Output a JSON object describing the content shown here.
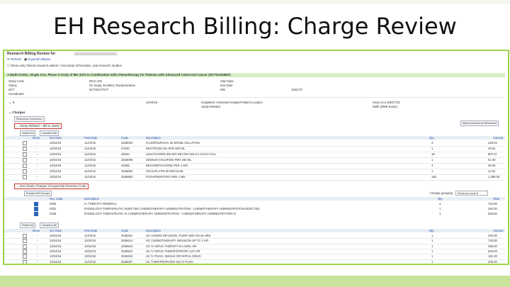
{
  "slide": {
    "title": "EH Research Billing: Charge Review"
  },
  "colors": {
    "frame": "#9bd34a",
    "banner": "#d6efc4",
    "highlight": "#d0342c"
  },
  "app": {
    "page_heading": "Research Billing Review for",
    "toolbar": {
      "refresh": "Refresh",
      "expand": "Expand/collapse"
    },
    "info_note": "Show only clinical research patient / encounter information, and research studies",
    "banner_text": "A Multi-Center, Single Arm, Phase II study of MK-3475 in Combination with Chemotherapy for Patients with Advanced Colorectal Cancer (NCT01234567)",
    "study_fields": [
      {
        "label": "Study Code",
        "value": "MCH-106"
      },
      {
        "label": "Status",
        "value": "On Study, Enrolled, Randomization"
      },
      {
        "label": "NCT",
        "value": "NCT02477677"
      },
      {
        "label": "Coordinator",
        "value": ""
      }
    ],
    "study_fields_right": [
      {
        "label": "Start Date",
        "value": ""
      },
      {
        "label": "End Date",
        "value": ""
      },
      {
        "label": "IRB",
        "value": "1502737"
      }
    ],
    "encounter": {
      "date": "10/24/16",
      "type": "Outpatient: Extended Hospital Patient Location",
      "related": "Study-Related",
      "account": "Hosp Acct 40637733",
      "dmr": "DMR (DMR Exam)"
    },
    "charges": {
      "tab_label": "Charges",
      "tab_sub": "Research Correction",
      "mark_reviewed": "Mark Account as Reviewed",
      "study_related_label": "Study-Related – Bill to Study",
      "select_all": "Select All",
      "unselect_all": "Unselect All",
      "columns": [
        "Move",
        "Svc Date",
        "Post Date",
        "Code",
        "Description",
        "Qty",
        "Amount"
      ],
      "study_rows": [
        {
          "svc": "10/24/16",
          "post": "11/10/16",
          "code": "2536002",
          "desc": "FLUOROURACIL 50 MG/ML SOLUTION",
          "qty": "4",
          "amt": "226.04"
        },
        {
          "svc": "10/24/16",
          "post": "11/10/16",
          "code": "27040",
          "desc": "DEXTROSE 5% PER 500 ML",
          "qty": "1",
          "amt": "40.51"
        },
        {
          "svc": "10/24/16",
          "post": "11/10/16",
          "code": "25040",
          "desc": "LEUCOVORIN 200 MG RECON SOLN 1 EACH VIAL",
          "qty": "18",
          "amt": "807.37"
        },
        {
          "svc": "10/24/16",
          "post": "11/10/16",
          "code": "2536009",
          "desc": "SODIUM CHLORIDE PER 250 ML",
          "qty": "1",
          "amt": "51.00"
        },
        {
          "svc": "10/24/16",
          "post": "11/10/16",
          "code": "25495",
          "desc": "DEXAMETHASONE PER 1 MG",
          "qty": "4",
          "amt": "40.93"
        },
        {
          "svc": "10/24/16",
          "post": "11/10/16",
          "code": "2536802",
          "desc": "OXALIPLATIN 50 MG/10 ML",
          "qty": "1",
          "amt": "11.52"
        },
        {
          "svc": "10/24/16",
          "post": "11/10/16",
          "code": "2536803",
          "desc": "FOSAPREPITANT PER 1 MG",
          "qty": "150",
          "amt": "1,386.00"
        }
      ],
      "non_study_label": "Non-Study Charges Grouped By Revenue Code",
      "expand_all": "Expand All Groups",
      "group_by_label": "Change grouping",
      "group_by_value": "Revenue code",
      "group_columns": [
        "Rev Code",
        "Description",
        "Qty",
        "Total"
      ],
      "groups": [
        {
          "code": "0260",
          "desc": "IV THERAPY-GENERAL",
          "qty": "4",
          "total": "734.00"
        },
        {
          "code": "0331",
          "desc": "RADIOLOGY-THERAPEUTIC-INJECTED CHEMOTHERAPY ADMINISTRATION - CHEMOTHERAPY ADMINISTRATION-INJECTED",
          "qty": "1",
          "total": "240.00"
        },
        {
          "code": "0335",
          "desc": "RADIOLOGY-THERAPEUTIC-IV CHEMOTHERAPY ADMINISTRATION - CHEMOTHERAPY ADMINISTRATION-IV",
          "qty": "1",
          "total": "520.60"
        }
      ],
      "non_study_rows": [
        {
          "svc": "10/24/16",
          "post": "11/10/16",
          "code": "2538451",
          "desc": "HC CHEMO INFUSION, PUMP ADD-ON 46 HRS",
          "qty": "1",
          "amt": "240.00"
        },
        {
          "svc": "10/24/16",
          "post": "10/24/16",
          "code": "2538614",
          "desc": "HC CHEMOTHERAPY INFUSION UP TO 1 HR",
          "qty": "1",
          "amt": "734.00"
        },
        {
          "svc": "10/24/16",
          "post": "10/24/16",
          "code": "2538523",
          "desc": "HC IV INFUS THERAPY EA ADDL HR",
          "qty": "1",
          "amt": "258.00"
        },
        {
          "svc": "10/24/16",
          "post": "10/24/16",
          "code": "2538522",
          "desc": "HC IV INFUS THER/DX/PROPH 1ST HR",
          "qty": "1",
          "amt": "526.00"
        },
        {
          "svc": "10/24/16",
          "post": "10/24/16",
          "code": "2538410",
          "desc": "HC IV PUSH, SINGLE OR INITIAL DRUG",
          "qty": "1",
          "amt": "181.00"
        },
        {
          "svc": "10/24/16",
          "post": "11/10/16",
          "code": "2538007",
          "desc": "HC THER/PROPH/DX INJ IV PUSH",
          "qty": "1",
          "amt": "205.00"
        }
      ]
    }
  }
}
